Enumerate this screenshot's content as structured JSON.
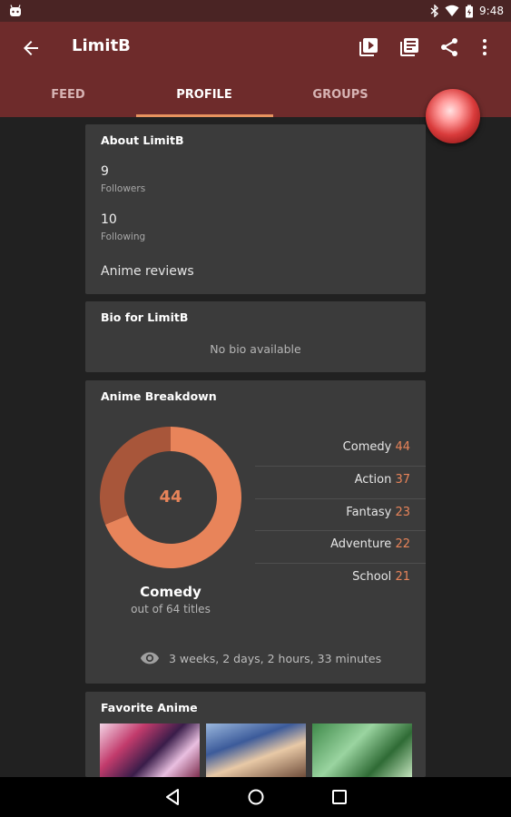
{
  "status_bar": {
    "time": "9:48"
  },
  "app_bar": {
    "title": "LimitB"
  },
  "tabs": [
    {
      "label": "FEED"
    },
    {
      "label": "PROFILE"
    },
    {
      "label": "GROUPS"
    }
  ],
  "about": {
    "title": "About LimitB",
    "followers_count": "9",
    "followers_label": "Followers",
    "following_count": "10",
    "following_label": "Following",
    "reviews_link": "Anime reviews"
  },
  "bio": {
    "title": "Bio for LimitB",
    "text": "No bio available"
  },
  "breakdown": {
    "title": "Anime Breakdown",
    "center_value": "44",
    "top_genre": "Comedy",
    "out_of": "out of 64 titles",
    "genres": [
      {
        "name": "Comedy",
        "count": "44"
      },
      {
        "name": "Action",
        "count": "37"
      },
      {
        "name": "Fantasy",
        "count": "23"
      },
      {
        "name": "Adventure",
        "count": "22"
      },
      {
        "name": "School",
        "count": "21"
      }
    ],
    "watch_time": "3 weeks, 2 days, 2 hours, 33 minutes"
  },
  "chart_data": {
    "type": "pie",
    "categories": [
      "Comedy",
      "Other"
    ],
    "values": [
      44,
      20
    ],
    "colors": [
      "#e8845a",
      "#a8563a"
    ]
  },
  "favorites": {
    "title": "Favorite Anime"
  },
  "colors": {
    "app_bar": "#6e2b2b",
    "accent": "#e8845a",
    "card": "#3b3b3b",
    "background": "#212121"
  }
}
